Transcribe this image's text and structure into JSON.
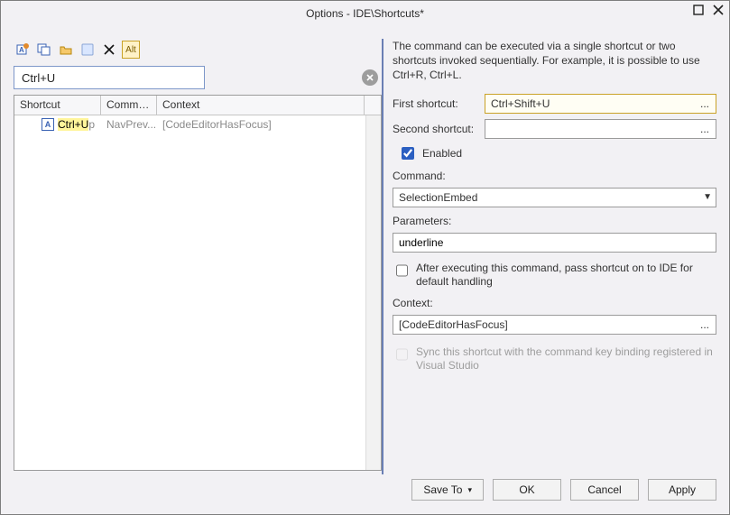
{
  "window": {
    "title": "Options - IDE\\Shortcuts*"
  },
  "toolbar": {
    "alt_label": "Alt"
  },
  "search": {
    "value": "Ctrl+U"
  },
  "grid": {
    "headers": {
      "shortcut": "Shortcut",
      "command": "Comma...",
      "context": "Context"
    },
    "rows": [
      {
        "shortcut_hl": "Ctrl+U",
        "shortcut_rest": "p",
        "command": "NavPrev...",
        "context": "[CodeEditorHasFocus]"
      }
    ]
  },
  "details": {
    "description": "The command can be executed via a single shortcut or two shortcuts invoked sequentially. For example, it is possible to use Ctrl+R, Ctrl+L.",
    "first_label": "First shortcut:",
    "first_value": "Ctrl+Shift+U",
    "second_label": "Second shortcut:",
    "second_value": "",
    "enabled_label": "Enabled",
    "enabled_checked": true,
    "command_label": "Command:",
    "command_value": "SelectionEmbed",
    "parameters_label": "Parameters:",
    "parameters_value": "underline",
    "pass_label": "After executing this command, pass shortcut on to IDE for default handling",
    "pass_checked": false,
    "context_label": "Context:",
    "context_value": "[CodeEditorHasFocus]",
    "sync_label": "Sync this shortcut with the command key binding registered in Visual Studio",
    "sync_checked": false
  },
  "buttons": {
    "save_to": "Save To",
    "ok": "OK",
    "cancel": "Cancel",
    "apply": "Apply"
  }
}
